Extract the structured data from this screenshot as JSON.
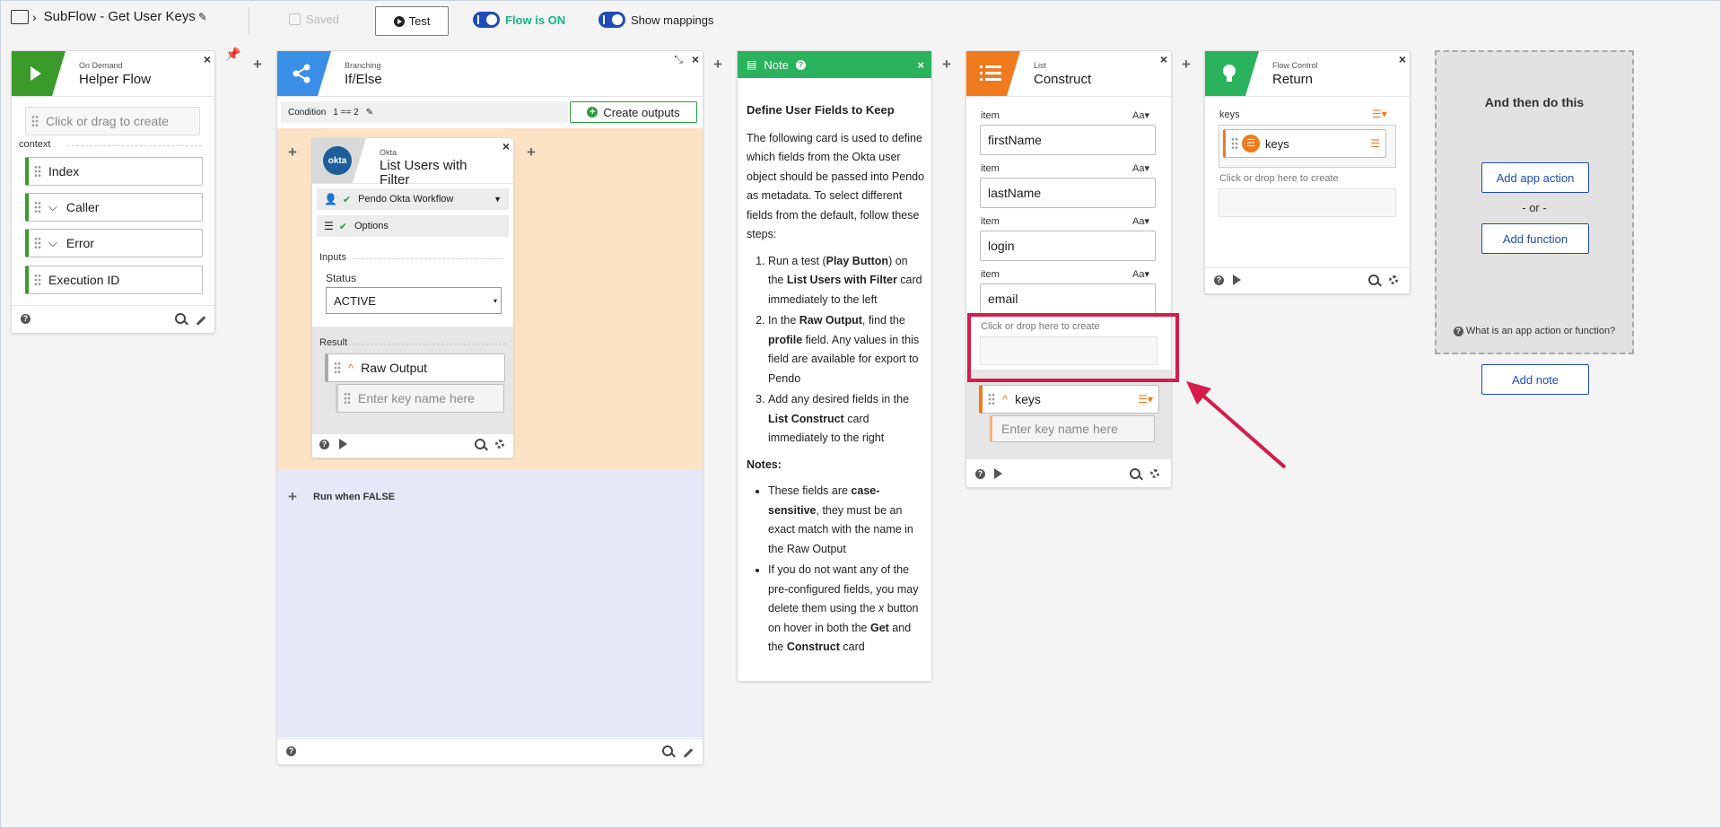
{
  "topbar": {
    "flow_title": "SubFlow - Get User Keys",
    "saved": "Saved",
    "test": "Test",
    "flow_status": "Flow is ON",
    "show_mappings": "Show mappings"
  },
  "colors": {
    "ondemand": "#3a9a2a",
    "branch": "#3a8ee6",
    "note": "#2ab25d",
    "list": "#f07a1e",
    "return": "#2ab25d",
    "accent": "#1f4cb8",
    "highlight": "#d51c4a",
    "if_bg": "#fce3c6",
    "else_bg": "#e5e9f7"
  },
  "helper": {
    "subtitle": "On Demand",
    "title": "Helper Flow",
    "create_placeholder": "Click or drag to create",
    "context_label": "context",
    "fields": [
      "Index",
      "Caller",
      "Error",
      "Execution ID"
    ]
  },
  "branch": {
    "subtitle": "Branching",
    "title": "If/Else",
    "condition_label": "Condition",
    "condition_value": "1 == 2",
    "create_outputs": "Create outputs",
    "run_false": "Run when FALSE"
  },
  "okta": {
    "subtitle": "Okta",
    "title": "List Users with Filter",
    "logo": "okta",
    "connection": "Pendo Okta Workflow",
    "options": "Options",
    "inputs_label": "Inputs",
    "status_label": "Status",
    "status_value": "ACTIVE",
    "result_label": "Result",
    "raw_output": "Raw Output",
    "key_placeholder": "Enter key name here"
  },
  "note": {
    "title": "Note",
    "heading": "Define User Fields to Keep",
    "intro": "The following card is used to define which fields from the Okta user object should be passed into Pendo as metadata. To select different fields from the default, follow these steps:",
    "steps": [
      {
        "a": "Run a test (",
        "b": "Play Button",
        "c": ") on the ",
        "d": "List Users with Filter",
        "e": " card immediately to the left"
      },
      {
        "a": "In the ",
        "b": "Raw Output",
        "c": ", find the ",
        "d": "profile",
        "e": " field. Any values in this field are available for export to Pendo"
      },
      {
        "a": "Add any desired fields in the ",
        "b": "List Construct",
        "c": " card immediately to the right",
        "d": "",
        "e": ""
      }
    ],
    "notes_label": "Notes:",
    "notes": [
      {
        "a": "These fields are ",
        "b": "case-sensitive",
        "c": ", they must be an exact match with the name in the Raw Output"
      },
      {
        "a": "If you do not want any of the pre-configured fields, you may delete them using the ",
        "b": "x",
        "c": " button on hover in both the ",
        "d": "Get",
        "e": " and the ",
        "f": "Construct",
        "g": " card"
      }
    ]
  },
  "list": {
    "subtitle": "List",
    "title": "Construct",
    "item_label": "item",
    "type_label": "Aa",
    "items": [
      "firstName",
      "lastName",
      "login",
      "email"
    ],
    "drop_hint": "Click or drop here to create",
    "output": "keys",
    "key_placeholder": "Enter key name here"
  },
  "ret": {
    "subtitle": "Flow Control",
    "title": "Return",
    "keys_label": "keys",
    "keys_field": "keys",
    "drop_hint": "Click or drop here to create"
  },
  "next": {
    "title": "And then do this",
    "add_app_action": "Add app action",
    "or": "- or -",
    "add_function": "Add function",
    "help": "What is an app action or function?",
    "add_note": "Add note"
  }
}
